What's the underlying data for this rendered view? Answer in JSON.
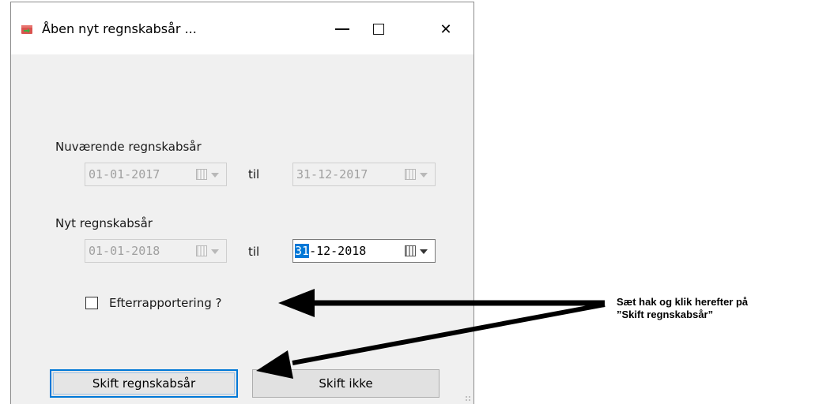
{
  "window": {
    "title": "Åben nyt regnskabsår ...",
    "controls": [
      "minimize",
      "maximize",
      "close"
    ],
    "close_glyph": "✕"
  },
  "current_year": {
    "label": "Nuværende regnskabsår",
    "from": "01-01-2017",
    "to_label": "til",
    "to": "31-12-2017",
    "enabled": false
  },
  "new_year": {
    "label": "Nyt regnskabsår",
    "from": "01-01-2018",
    "to_label": "til",
    "to_selected": "31",
    "to_rest": "-12-2018",
    "from_enabled": false,
    "to_enabled": true
  },
  "backreport": {
    "label": "Efterrapportering ?",
    "checked": false
  },
  "buttons": {
    "change": "Skift regnskabsår",
    "dont_change": "Skift ikke"
  },
  "annotation": {
    "line1": "Sæt hak og klik herefter på",
    "line2": "”Skift regnskabsår”"
  },
  "colors": {
    "accent": "#0078d7",
    "window_bg": "#f0f0f0",
    "arrow": "#000000"
  }
}
